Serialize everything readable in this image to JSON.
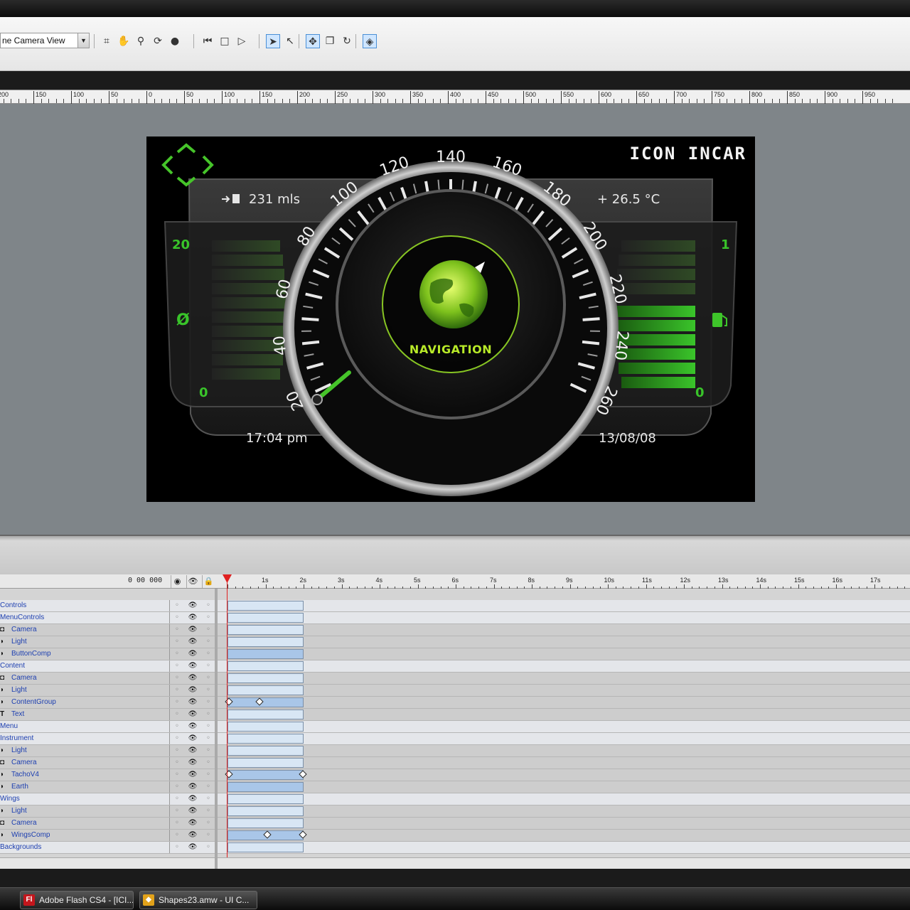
{
  "toolbar": {
    "view_select_value": "ne Camera View",
    "tools": [
      "select-region-icon",
      "hand-icon",
      "zoom-icon",
      "orbit-icon",
      "sphere-icon",
      "frame-back-icon",
      "frame-box-icon",
      "frame-forward-icon",
      "arrow-select-icon",
      "subselect-icon",
      "move-icon",
      "copy-icon",
      "rotate-icon",
      "snap-icon"
    ]
  },
  "ruler": {
    "labels": [
      "200",
      "150",
      "100",
      "50",
      "0",
      "50",
      "100",
      "150",
      "200",
      "250",
      "300",
      "350",
      "400",
      "450",
      "500",
      "550",
      "600",
      "650",
      "700",
      "750",
      "800",
      "850",
      "900",
      "950"
    ]
  },
  "dashboard": {
    "brand": "ICON INCAR",
    "range": "231 mls",
    "temperature": "+ 26.5 °C",
    "time": "17:04 pm",
    "date": "13/08/08",
    "center_label": "NAVIGATION",
    "left_gauge_top": "20",
    "left_gauge_mid": "Ø",
    "left_gauge_bottom": "0",
    "right_gauge_top": "1",
    "right_gauge_bottom": "0",
    "speed_labels": [
      "20",
      "40",
      "60",
      "80",
      "100",
      "120",
      "140",
      "160",
      "180",
      "200",
      "220",
      "240",
      "260"
    ],
    "accent_color": "#3ec52a",
    "nav_color": "#b8ea28"
  },
  "timeline": {
    "time_display": "0 00 000",
    "ticks": [
      "1s",
      "2s",
      "3s",
      "4s",
      "5s",
      "6s",
      "7s",
      "8s",
      "9s",
      "10s",
      "11s",
      "12s",
      "13s",
      "14s",
      "15s",
      "16s",
      "17s"
    ],
    "layers": [
      {
        "name": "Controls",
        "group": true,
        "glyph": "",
        "active": false,
        "keyframes": []
      },
      {
        "name": "MenuControls",
        "group": true,
        "glyph": "",
        "active": false,
        "keyframes": []
      },
      {
        "name": "Camera",
        "group": false,
        "glyph": "◘",
        "active": false,
        "keyframes": []
      },
      {
        "name": "Light",
        "group": false,
        "glyph": "◗",
        "active": false,
        "keyframes": []
      },
      {
        "name": "ButtonComp",
        "group": false,
        "glyph": "◗",
        "active": true,
        "keyframes": []
      },
      {
        "name": "Content",
        "group": true,
        "glyph": "",
        "active": false,
        "keyframes": []
      },
      {
        "name": "Camera",
        "group": false,
        "glyph": "◘",
        "active": false,
        "keyframes": []
      },
      {
        "name": "Light",
        "group": false,
        "glyph": "◗",
        "active": false,
        "keyframes": []
      },
      {
        "name": "ContentGroup",
        "group": false,
        "glyph": "◗",
        "active": true,
        "keyframes": [
          0,
          0.4
        ]
      },
      {
        "name": "Text",
        "group": false,
        "glyph": "T",
        "active": false,
        "keyframes": []
      },
      {
        "name": "Menu",
        "group": true,
        "glyph": "",
        "active": false,
        "keyframes": []
      },
      {
        "name": "Instrument",
        "group": true,
        "glyph": "",
        "active": false,
        "keyframes": []
      },
      {
        "name": "Light",
        "group": false,
        "glyph": "◗",
        "active": false,
        "keyframes": []
      },
      {
        "name": "Camera",
        "group": false,
        "glyph": "◘",
        "active": false,
        "keyframes": []
      },
      {
        "name": "TachoV4",
        "group": false,
        "glyph": "◗",
        "active": true,
        "keyframes": [
          0,
          0.97
        ]
      },
      {
        "name": "Earth",
        "group": false,
        "glyph": "◗",
        "active": true,
        "keyframes": []
      },
      {
        "name": "Wings",
        "group": true,
        "glyph": "",
        "active": false,
        "keyframes": []
      },
      {
        "name": "Light",
        "group": false,
        "glyph": "◗",
        "active": false,
        "keyframes": []
      },
      {
        "name": "Camera",
        "group": false,
        "glyph": "◘",
        "active": false,
        "keyframes": []
      },
      {
        "name": "WingsComp",
        "group": false,
        "glyph": "◗",
        "active": true,
        "keyframes": [
          0.5,
          0.97
        ]
      },
      {
        "name": "Backgrounds",
        "group": true,
        "glyph": "",
        "active": false,
        "keyframes": []
      }
    ]
  },
  "taskbar": {
    "items": [
      {
        "label": "Adobe Flash CS4 - [ICI...",
        "icon": "flash-icon",
        "color": "#c4161c"
      },
      {
        "label": "Shapes23.amw - UI C...",
        "icon": "app-icon",
        "color": "#e2a21a"
      }
    ]
  }
}
